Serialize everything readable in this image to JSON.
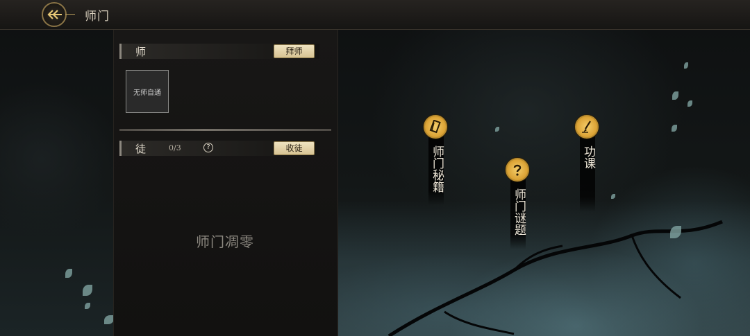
{
  "header": {
    "title": "师门"
  },
  "master_section": {
    "label": "师",
    "action_label": "拜师",
    "card_text": "无师自通"
  },
  "disciple_section": {
    "label": "徒",
    "count": "0/3",
    "help_glyph": "?",
    "action_label": "收徒",
    "empty_text": "师门凋零"
  },
  "features": [
    {
      "label": "师门秘籍",
      "icon": "book-icon"
    },
    {
      "label": "师门谜题",
      "icon": "question-icon"
    },
    {
      "label": "功课",
      "icon": "brush-icon"
    }
  ],
  "colors": {
    "gold_button": "#e8dab2",
    "feature_icon": "#e3b04a",
    "accent_line": "#b99d5c"
  }
}
